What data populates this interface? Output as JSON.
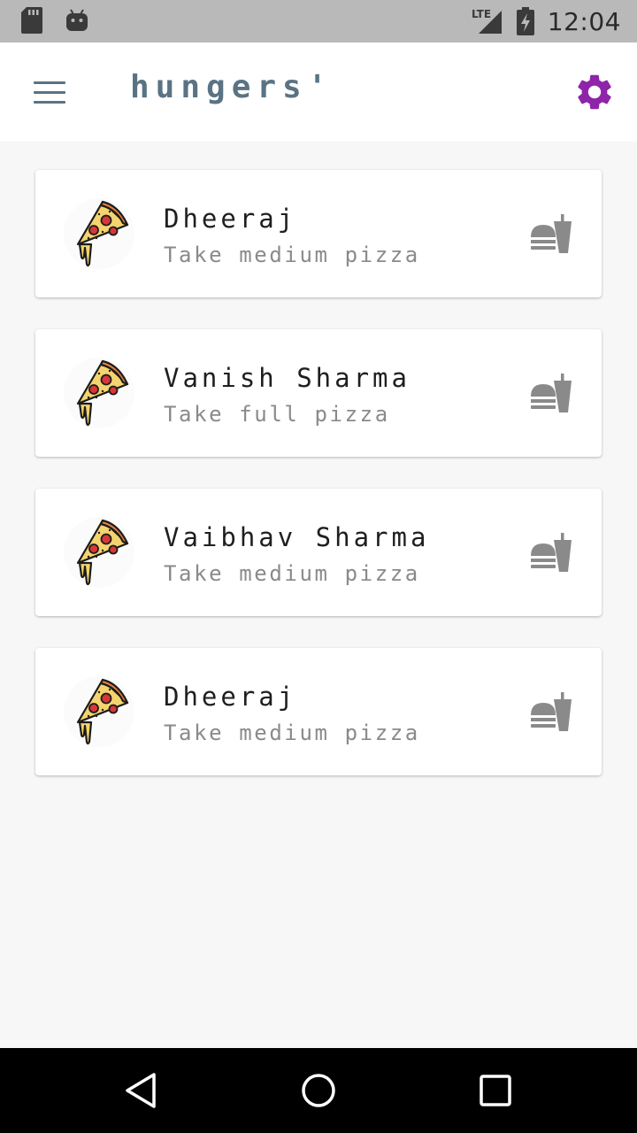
{
  "status_bar": {
    "time": "12:04",
    "network_label": "LTE",
    "icons": [
      "sd-card-icon",
      "android-icon",
      "lte-signal-icon",
      "battery-charging-icon"
    ]
  },
  "app_bar": {
    "title": "hungers'",
    "menu_icon": "hamburger-menu-icon",
    "settings_icon": "gear-icon",
    "accent_color": "#8e24aa",
    "title_color": "#5a7384"
  },
  "orders": [
    {
      "name": "Dheeraj",
      "request": "Take medium pizza",
      "avatar_icon": "pizza-slice-icon",
      "action_icon": "fastfood-icon"
    },
    {
      "name": "Vanish Sharma",
      "request": "Take full pizza",
      "avatar_icon": "pizza-slice-icon",
      "action_icon": "fastfood-icon"
    },
    {
      "name": "Vaibhav Sharma",
      "request": "Take medium pizza",
      "avatar_icon": "pizza-slice-icon",
      "action_icon": "fastfood-icon"
    },
    {
      "name": "Dheeraj",
      "request": "Take medium pizza",
      "avatar_icon": "pizza-slice-icon",
      "action_icon": "fastfood-icon"
    }
  ],
  "nav_bar": {
    "buttons": [
      "back-triangle-icon",
      "home-circle-icon",
      "recents-square-icon"
    ]
  }
}
